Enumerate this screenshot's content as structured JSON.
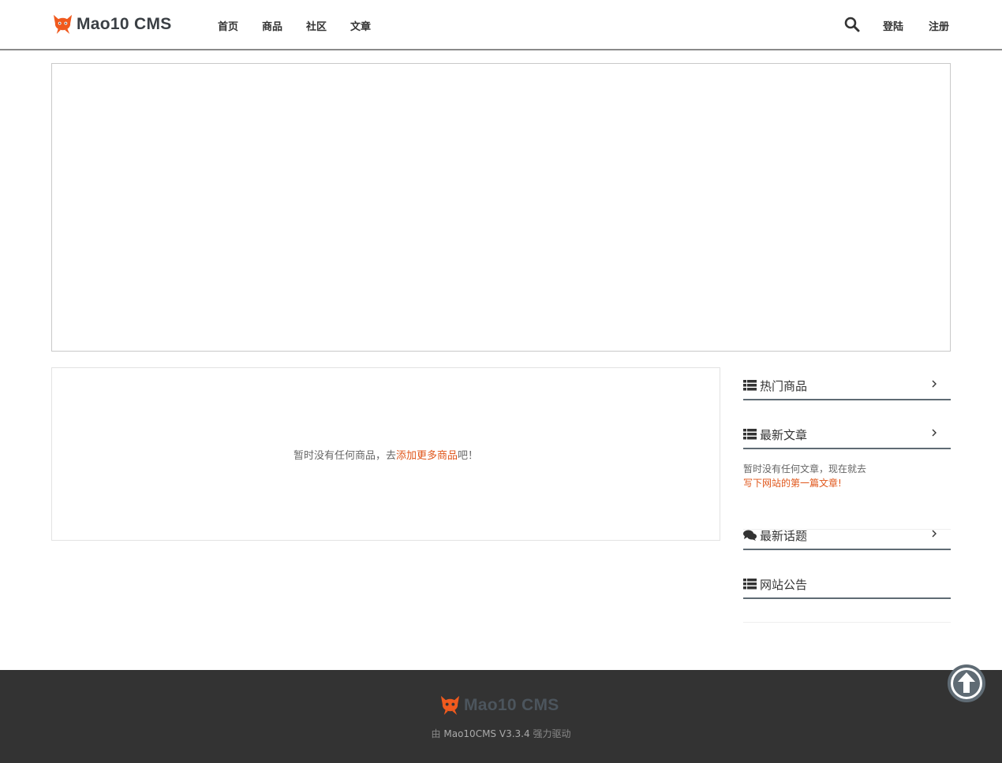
{
  "header": {
    "logo_text": "Mao10 CMS",
    "nav": [
      "首页",
      "商品",
      "社区",
      "文章"
    ],
    "login_label": "登陆",
    "register_label": "注册"
  },
  "products": {
    "empty_prefix": "暂时没有任何商品，去",
    "empty_link": "添加更多商品",
    "empty_suffix": "吧！"
  },
  "sidebar": {
    "hot_products": {
      "title": "热门商品"
    },
    "latest_articles": {
      "title": "最新文章",
      "empty_text": "暂时没有任何文章，现在就去",
      "empty_link": "写下网站的第一篇文章!"
    },
    "latest_topics": {
      "title": "最新话题"
    },
    "announcements": {
      "title": "网站公告"
    }
  },
  "footer": {
    "logo_text": "Mao10 CMS",
    "powered_prefix": "由",
    "powered_name": "Mao10CMS V3.3.4",
    "powered_suffix": "强力驱动"
  },
  "colors": {
    "accent": "#e0561a",
    "logo_orange": "#f05a1e",
    "footer_bg": "#333333",
    "widget_border": "#5f6b74"
  },
  "icons": {
    "logo": "fox-logo-icon",
    "search": "search-icon",
    "list": "list-icon",
    "comments": "comments-icon",
    "chevron": "chevron-right-icon",
    "to_top": "arrow-up-circle-icon"
  }
}
